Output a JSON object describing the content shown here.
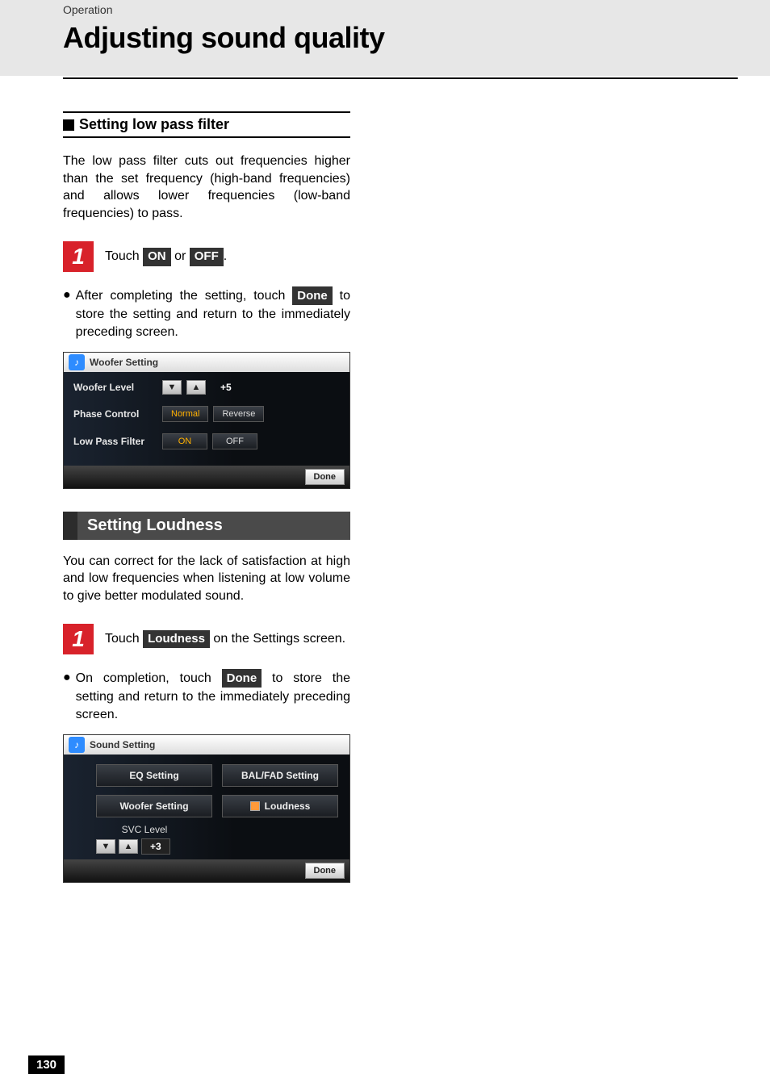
{
  "breadcrumb": "Operation",
  "title": "Adjusting sound quality",
  "lowpass": {
    "heading": "Setting low pass filter",
    "intro": "The low pass filter cuts out frequencies higher than the set frequency (high-band frequencies) and allows lower frequencies (low-band frequencies) to pass.",
    "step_num": "1",
    "step_prefix": "Touch ",
    "btn_on": "ON",
    "step_or": " or ",
    "btn_off": "OFF",
    "step_suffix": ".",
    "bullet_prefix": "After completing the setting, touch ",
    "btn_done": "Done",
    "bullet_suffix": " to store the setting and return to the immediately preceding screen."
  },
  "woofer_shot": {
    "title": "Woofer Setting",
    "rows": {
      "level": {
        "label": "Woofer Level",
        "value": "+5"
      },
      "phase": {
        "label": "Phase Control",
        "opt1": "Normal",
        "opt2": "Reverse"
      },
      "lpf": {
        "label": "Low Pass Filter",
        "opt1": "ON",
        "opt2": "OFF"
      }
    },
    "done": "Done"
  },
  "loudness": {
    "heading": "Setting Loudness",
    "intro": "You can correct for the lack of satisfaction at high and low frequencies when listening at low volume to give better modulated sound.",
    "step_num": "1",
    "step_prefix": "Touch ",
    "btn_loudness": "Loudness",
    "step_suffix": " on the Settings screen.",
    "bullet_prefix": "On completion, touch ",
    "btn_done": "Done",
    "bullet_suffix": " to store the setting and return to the immediately preceding screen."
  },
  "sound_shot": {
    "title": "Sound Setting",
    "eq": "EQ Setting",
    "balfad": "BAL/FAD Setting",
    "woofer": "Woofer Setting",
    "loudness": "Loudness",
    "svc_label": "SVC Level",
    "svc_value": "+3",
    "done": "Done"
  },
  "arrows": {
    "down": "▼",
    "up": "▲"
  },
  "page_number": "130"
}
